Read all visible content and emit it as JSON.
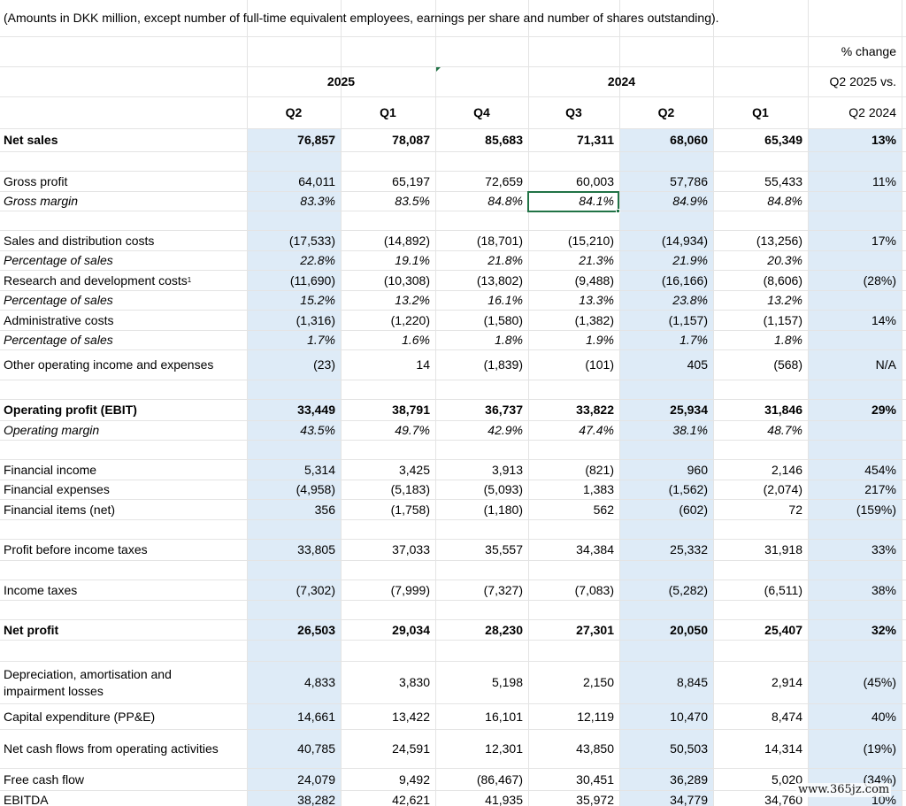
{
  "note": "(Amounts in DKK million, except number of full-time equivalent employees, earnings per share and number of shares outstanding).",
  "header": {
    "pct_change": "% change",
    "year_2025": "2025",
    "year_2024": "2024",
    "pct_vs": "Q2 2025 vs.",
    "pct_base": "Q2 2024",
    "quarters": [
      "Q2",
      "Q1",
      "Q4",
      "Q3",
      "Q2",
      "Q1"
    ]
  },
  "rows": [
    {
      "label": "Net sales",
      "values": [
        "76,857",
        "78,087",
        "85,683",
        "71,311",
        "68,060",
        "65,349"
      ],
      "change": "13%"
    },
    {
      "label": "Gross profit",
      "values": [
        "64,011",
        "65,197",
        "72,659",
        "60,003",
        "57,786",
        "55,433"
      ],
      "change": "11%"
    },
    {
      "label": "Gross margin",
      "values": [
        "83.3%",
        "83.5%",
        "84.8%",
        "84.1%",
        "84.9%",
        "84.8%"
      ],
      "change": ""
    },
    {
      "label": "Sales and distribution costs",
      "values": [
        "(17,533)",
        "(14,892)",
        "(18,701)",
        "(15,210)",
        "(14,934)",
        "(13,256)"
      ],
      "change": "17%"
    },
    {
      "label": "Percentage of sales",
      "values": [
        "22.8%",
        "19.1%",
        "21.8%",
        "21.3%",
        "21.9%",
        "20.3%"
      ],
      "change": ""
    },
    {
      "label": "Research and development costs",
      "footnote": "1",
      "values": [
        "(11,690)",
        "(10,308)",
        "(13,802)",
        "(9,488)",
        "(16,166)",
        "(8,606)"
      ],
      "change": "(28%)"
    },
    {
      "label": "Percentage of sales",
      "values": [
        "15.2%",
        "13.2%",
        "16.1%",
        "13.3%",
        "23.8%",
        "13.2%"
      ],
      "change": ""
    },
    {
      "label": "Administrative costs",
      "values": [
        "(1,316)",
        "(1,220)",
        "(1,580)",
        "(1,382)",
        "(1,157)",
        "(1,157)"
      ],
      "change": "14%"
    },
    {
      "label": "Percentage of sales",
      "values": [
        "1.7%",
        "1.6%",
        "1.8%",
        "1.9%",
        "1.7%",
        "1.8%"
      ],
      "change": ""
    },
    {
      "label": "Other operating income and expenses",
      "values": [
        "(23)",
        "14",
        "(1,839)",
        "(101)",
        "405",
        "(568)"
      ],
      "change": "N/A"
    },
    {
      "label": "Operating profit (EBIT)",
      "values": [
        "33,449",
        "38,791",
        "36,737",
        "33,822",
        "25,934",
        "31,846"
      ],
      "change": "29%"
    },
    {
      "label": "Operating margin",
      "values": [
        "43.5%",
        "49.7%",
        "42.9%",
        "47.4%",
        "38.1%",
        "48.7%"
      ],
      "change": ""
    },
    {
      "label": "Financial income",
      "values": [
        "5,314",
        "3,425",
        "3,913",
        "(821)",
        "960",
        "2,146"
      ],
      "change": "454%"
    },
    {
      "label": "Financial expenses",
      "values": [
        "(4,958)",
        "(5,183)",
        "(5,093)",
        "1,383",
        "(1,562)",
        "(2,074)"
      ],
      "change": "217%"
    },
    {
      "label": "Financial items (net)",
      "values": [
        "356",
        "(1,758)",
        "(1,180)",
        "562",
        "(602)",
        "72"
      ],
      "change": "(159%)"
    },
    {
      "label": "Profit before income taxes",
      "values": [
        "33,805",
        "37,033",
        "35,557",
        "34,384",
        "25,332",
        "31,918"
      ],
      "change": "33%"
    },
    {
      "label": "Income taxes",
      "values": [
        "(7,302)",
        "(7,999)",
        "(7,327)",
        "(7,083)",
        "(5,282)",
        "(6,511)"
      ],
      "change": "38%"
    },
    {
      "label": "Net profit",
      "values": [
        "26,503",
        "29,034",
        "28,230",
        "27,301",
        "20,050",
        "25,407"
      ],
      "change": "32%"
    },
    {
      "label": "Depreciation, amortisation and impairment losses",
      "values": [
        "4,833",
        "3,830",
        "5,198",
        "2,150",
        "8,845",
        "2,914"
      ],
      "change": "(45%)"
    },
    {
      "label": "Capital expenditure (PP&E)",
      "values": [
        "14,661",
        "13,422",
        "16,101",
        "12,119",
        "10,470",
        "8,474"
      ],
      "change": "40%"
    },
    {
      "label": "Net cash flows from operating activities",
      "values": [
        "40,785",
        "24,591",
        "12,301",
        "43,850",
        "50,503",
        "14,314"
      ],
      "change": "(19%)"
    },
    {
      "label": "Free cash flow",
      "values": [
        "24,079",
        "9,492",
        "(86,467)",
        "30,451",
        "36,289",
        "5,020"
      ],
      "change": "(34%)"
    },
    {
      "label": "EBITDA",
      "values": [
        "38,282",
        "42,621",
        "41,935",
        "35,972",
        "34,779",
        "34,760"
      ],
      "change": "10%"
    }
  ],
  "watermark": "www.365jz.com"
}
